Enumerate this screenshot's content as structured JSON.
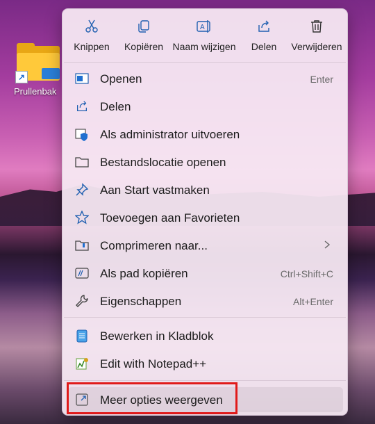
{
  "desktop": {
    "icon_label": "Prullenbak"
  },
  "toolbar": {
    "cut": "Knippen",
    "copy": "Kopiëren",
    "rename": "Naam wijzigen",
    "share": "Delen",
    "delete": "Verwijderen"
  },
  "menu": {
    "items": [
      {
        "label": "Openen",
        "shortcut": "Enter",
        "icon": "open-icon"
      },
      {
        "label": "Delen",
        "shortcut": "",
        "icon": "share-icon"
      },
      {
        "label": "Als administrator uitvoeren",
        "shortcut": "",
        "icon": "shield-icon"
      },
      {
        "label": "Bestandslocatie openen",
        "shortcut": "",
        "icon": "folder-icon"
      },
      {
        "label": "Aan Start vastmaken",
        "shortcut": "",
        "icon": "pin-icon"
      },
      {
        "label": "Toevoegen aan Favorieten",
        "shortcut": "",
        "icon": "star-icon"
      },
      {
        "label": "Comprimeren naar...",
        "shortcut": "",
        "icon": "zip-icon"
      },
      {
        "label": "Als pad kopiëren",
        "shortcut": "Ctrl+Shift+C",
        "icon": "copy-path-icon"
      },
      {
        "label": "Eigenschappen",
        "shortcut": "Alt+Enter",
        "icon": "wrench-icon"
      }
    ],
    "app_items": [
      {
        "label": "Bewerken in Kladblok",
        "icon": "notepad-icon"
      },
      {
        "label": "Edit with Notepad++",
        "icon": "notepadpp-icon"
      }
    ],
    "more_options": "Meer opties weergeven"
  },
  "colors": {
    "accent": "#1f6fd0",
    "highlight_border": "#e01a1a",
    "menu_bg": "#f6e9f3"
  }
}
